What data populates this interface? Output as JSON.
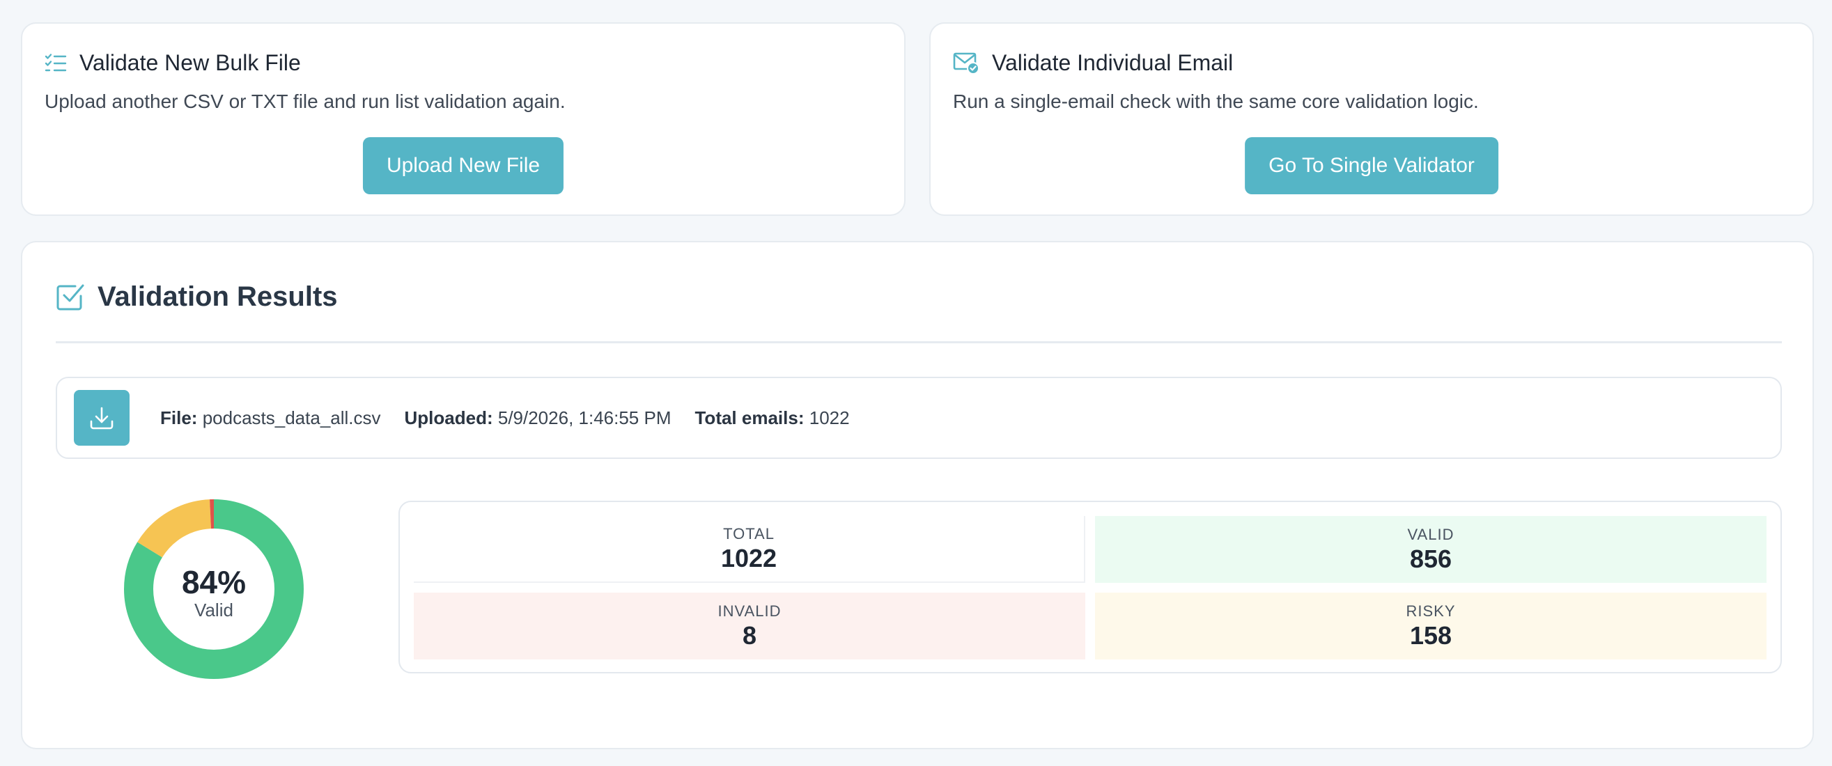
{
  "bulk_card": {
    "title": "Validate New Bulk File",
    "description": "Upload another CSV or TXT file and run list validation again.",
    "button_label": "Upload New File",
    "icon": "list-check-icon"
  },
  "single_card": {
    "title": "Validate Individual Email",
    "description": "Run a single-email check with the same core validation logic.",
    "button_label": "Go To Single Validator",
    "icon": "envelope-check-icon"
  },
  "results": {
    "title": "Validation Results",
    "icon": "checkbox-icon",
    "file": {
      "file_label": "File:",
      "file_name": "podcasts_data_all.csv",
      "uploaded_label": "Uploaded:",
      "uploaded_value": "5/9/2026, 1:46:55 PM",
      "total_label": "Total emails:",
      "total_value": "1022",
      "icon": "download-icon"
    },
    "donut": {
      "percent_text": "84%",
      "label": "Valid",
      "segments": [
        {
          "name": "valid",
          "value": 856,
          "color": "#4ac88a"
        },
        {
          "name": "risky",
          "value": 158,
          "color": "#f6c453"
        },
        {
          "name": "invalid",
          "value": 8,
          "color": "#e0534a"
        }
      ]
    },
    "stats": {
      "total": {
        "label": "TOTAL",
        "value": "1022"
      },
      "valid": {
        "label": "VALID",
        "value": "856"
      },
      "invalid": {
        "label": "INVALID",
        "value": "8"
      },
      "risky": {
        "label": "RISKY",
        "value": "158"
      }
    }
  },
  "colors": {
    "accent": "#55b5c6",
    "valid": "#4ac88a",
    "risky": "#f6c453",
    "invalid": "#e0534a"
  }
}
